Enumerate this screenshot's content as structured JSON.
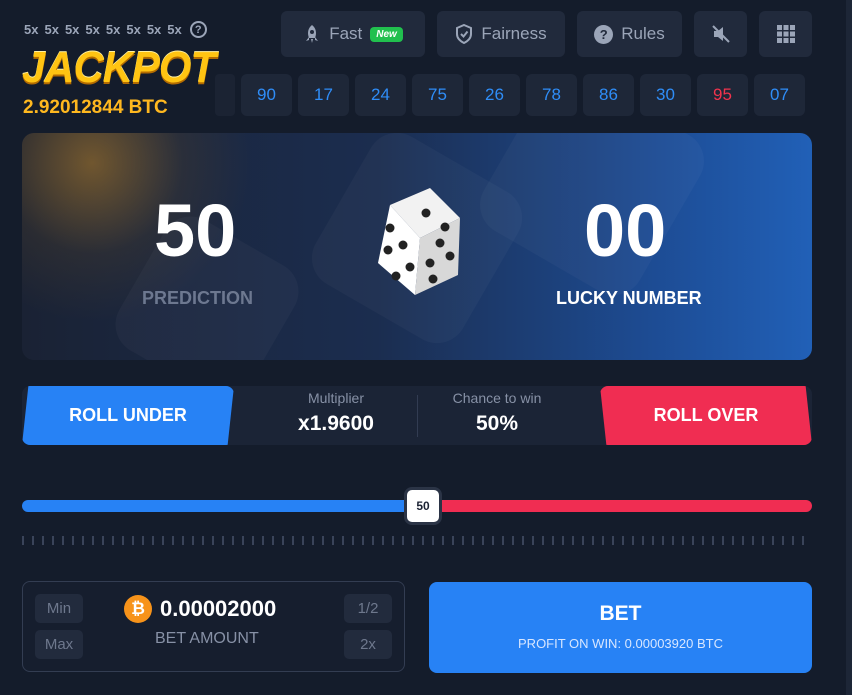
{
  "header": {
    "multipliers": [
      "5x",
      "5x",
      "5x",
      "5x",
      "5x",
      "5x",
      "5x",
      "5x"
    ],
    "jackpot_title": "JACKPOT",
    "jackpot_amount": "2.92012844 BTC",
    "buttons": {
      "fast_label": "Fast",
      "fast_badge": "New",
      "fairness_label": "Fairness",
      "rules_label": "Rules"
    }
  },
  "history": [
    {
      "value": "90",
      "color": "blue"
    },
    {
      "value": "17",
      "color": "blue"
    },
    {
      "value": "24",
      "color": "blue"
    },
    {
      "value": "75",
      "color": "blue"
    },
    {
      "value": "26",
      "color": "blue"
    },
    {
      "value": "78",
      "color": "blue"
    },
    {
      "value": "86",
      "color": "blue"
    },
    {
      "value": "30",
      "color": "blue"
    },
    {
      "value": "95",
      "color": "red"
    },
    {
      "value": "07",
      "color": "blue"
    }
  ],
  "panel": {
    "prediction_value": "50",
    "prediction_label": "PREDICTION",
    "lucky_value": "00",
    "lucky_label": "LUCKY NUMBER"
  },
  "roll": {
    "under_label": "ROLL UNDER",
    "over_label": "ROLL OVER",
    "multiplier_label": "Multiplier",
    "multiplier_value": "x1.9600",
    "chance_label": "Chance to win",
    "chance_value": "50%"
  },
  "slider": {
    "value_label": "50",
    "value_fraction": 0.5
  },
  "bet": {
    "min_label": "Min",
    "max_label": "Max",
    "half_label": "1/2",
    "double_label": "2x",
    "currency_symbol": "₿",
    "amount": "0.00002000",
    "amount_label": "BET AMOUNT",
    "button_label": "BET",
    "profit_text": "PROFIT ON WIN: 0.00003920 BTC"
  },
  "colors": {
    "blue": "#2782f5",
    "red": "#f02d52",
    "gold": "#ffc412",
    "background": "#141c2b"
  },
  "icons": [
    "help-icon",
    "rocket-icon",
    "shield-icon",
    "question-icon",
    "sound-muted-icon",
    "grid-icon",
    "dice-icon",
    "bitcoin-icon"
  ]
}
